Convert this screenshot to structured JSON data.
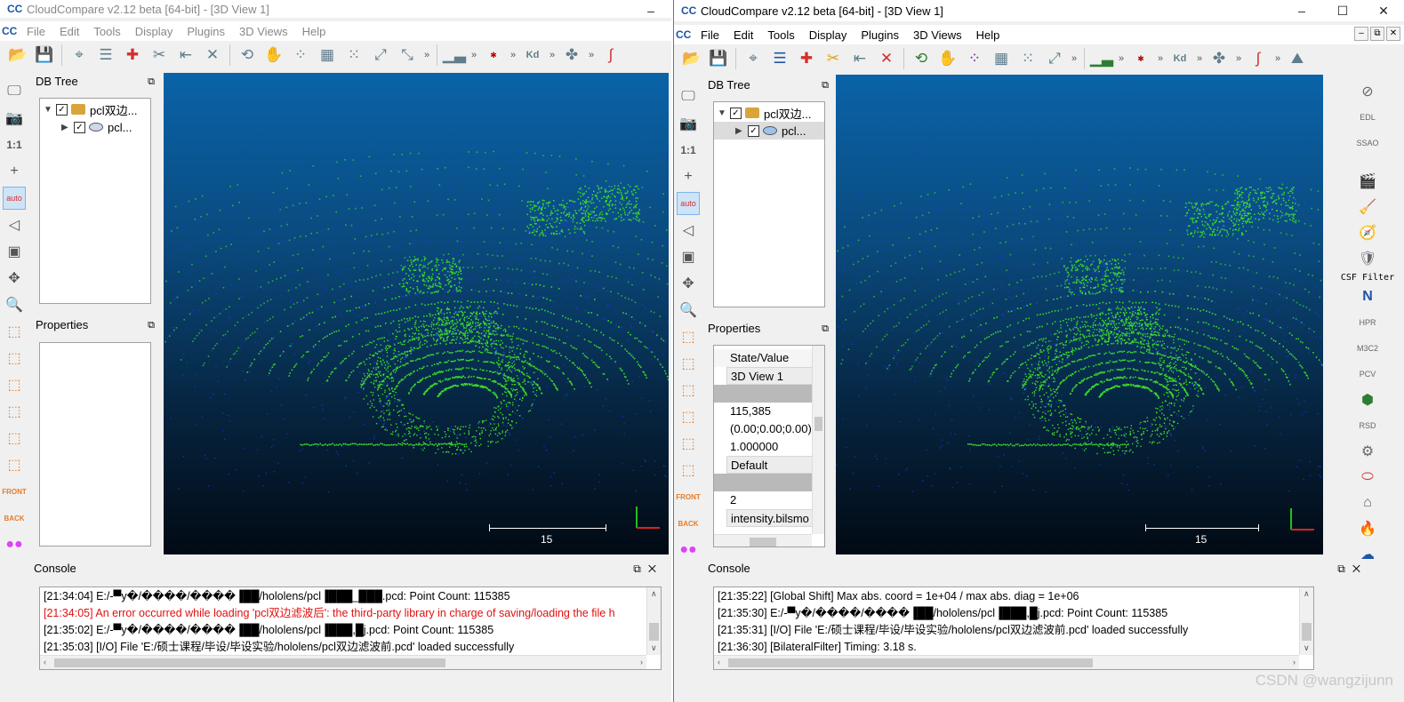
{
  "left": {
    "title": "CloudCompare v2.12 beta [64-bit] - [3D View 1]",
    "menu": [
      "File",
      "Edit",
      "Tools",
      "Display",
      "Plugins",
      "3D Views",
      "Help"
    ],
    "db_tree_title": "DB Tree",
    "tree": [
      {
        "label": "pcl双边..."
      },
      {
        "label": "pcl..."
      }
    ],
    "properties_title": "Properties",
    "scale_label": "15",
    "console_title": "Console",
    "console": [
      {
        "text": "[21:34:04] E:/-▀y�/����/����▐██/hololens/pcl▐███_███.pcd: Point Count: 115385",
        "error": false
      },
      {
        "text": "[21:34:05] An error occurred while loading 'pcl双边滤波后': the third-party library in charge of saving/loading the file h",
        "error": true
      },
      {
        "text": "[21:35:02] E:/-▀y�/����/����▐██/hololens/pcl▐███,█j.pcd: Point Count: 115385",
        "error": false
      },
      {
        "text": "[21:35:03] [I/O] File 'E:/硕士课程/毕设/毕设实验/hololens/pcl双边滤波前.pcd' loaded successfully",
        "error": false
      }
    ]
  },
  "right": {
    "title": "CloudCompare v2.12 beta [64-bit] - [3D View 1]",
    "menu": [
      "File",
      "Edit",
      "Tools",
      "Display",
      "Plugins",
      "3D Views",
      "Help"
    ],
    "db_tree_title": "DB Tree",
    "tree": [
      {
        "label": "pcl双边..."
      },
      {
        "label": "pcl..."
      }
    ],
    "properties_title": "Properties",
    "properties": {
      "header": "State/Value",
      "rows": [
        "3D View 1",
        "",
        "115,385",
        "(0.00;0.00;0.00)",
        "1.000000",
        "Default",
        "",
        "2",
        "intensity.bilsmo"
      ]
    },
    "scale_label": "15",
    "csf_label": "CSF Filter",
    "console_title": "Console",
    "console": [
      {
        "text": "[21:35:22] [Global Shift] Max abs. coord = 1e+04 / max abs. diag = 1e+06",
        "error": false
      },
      {
        "text": "[21:35:30] E:/-▀y�/����/����▐██/hololens/pcl▐███,█j.pcd: Point Count: 115385",
        "error": false
      },
      {
        "text": "[21:35:31] [I/O] File 'E:/硕士课程/毕设/毕设实验/hololens/pcl双边滤波前.pcd' loaded successfully",
        "error": false
      },
      {
        "text": "[21:36:30] [BilateralFilter] Timing: 3.18 s.",
        "error": false
      }
    ]
  },
  "watermark": "CSDN @wangzijunn",
  "colors": {
    "points_green": "#3ddc2a",
    "points_blue": "#1a3adf",
    "error_red": "#e01010",
    "accent": "#3b7dd8"
  }
}
